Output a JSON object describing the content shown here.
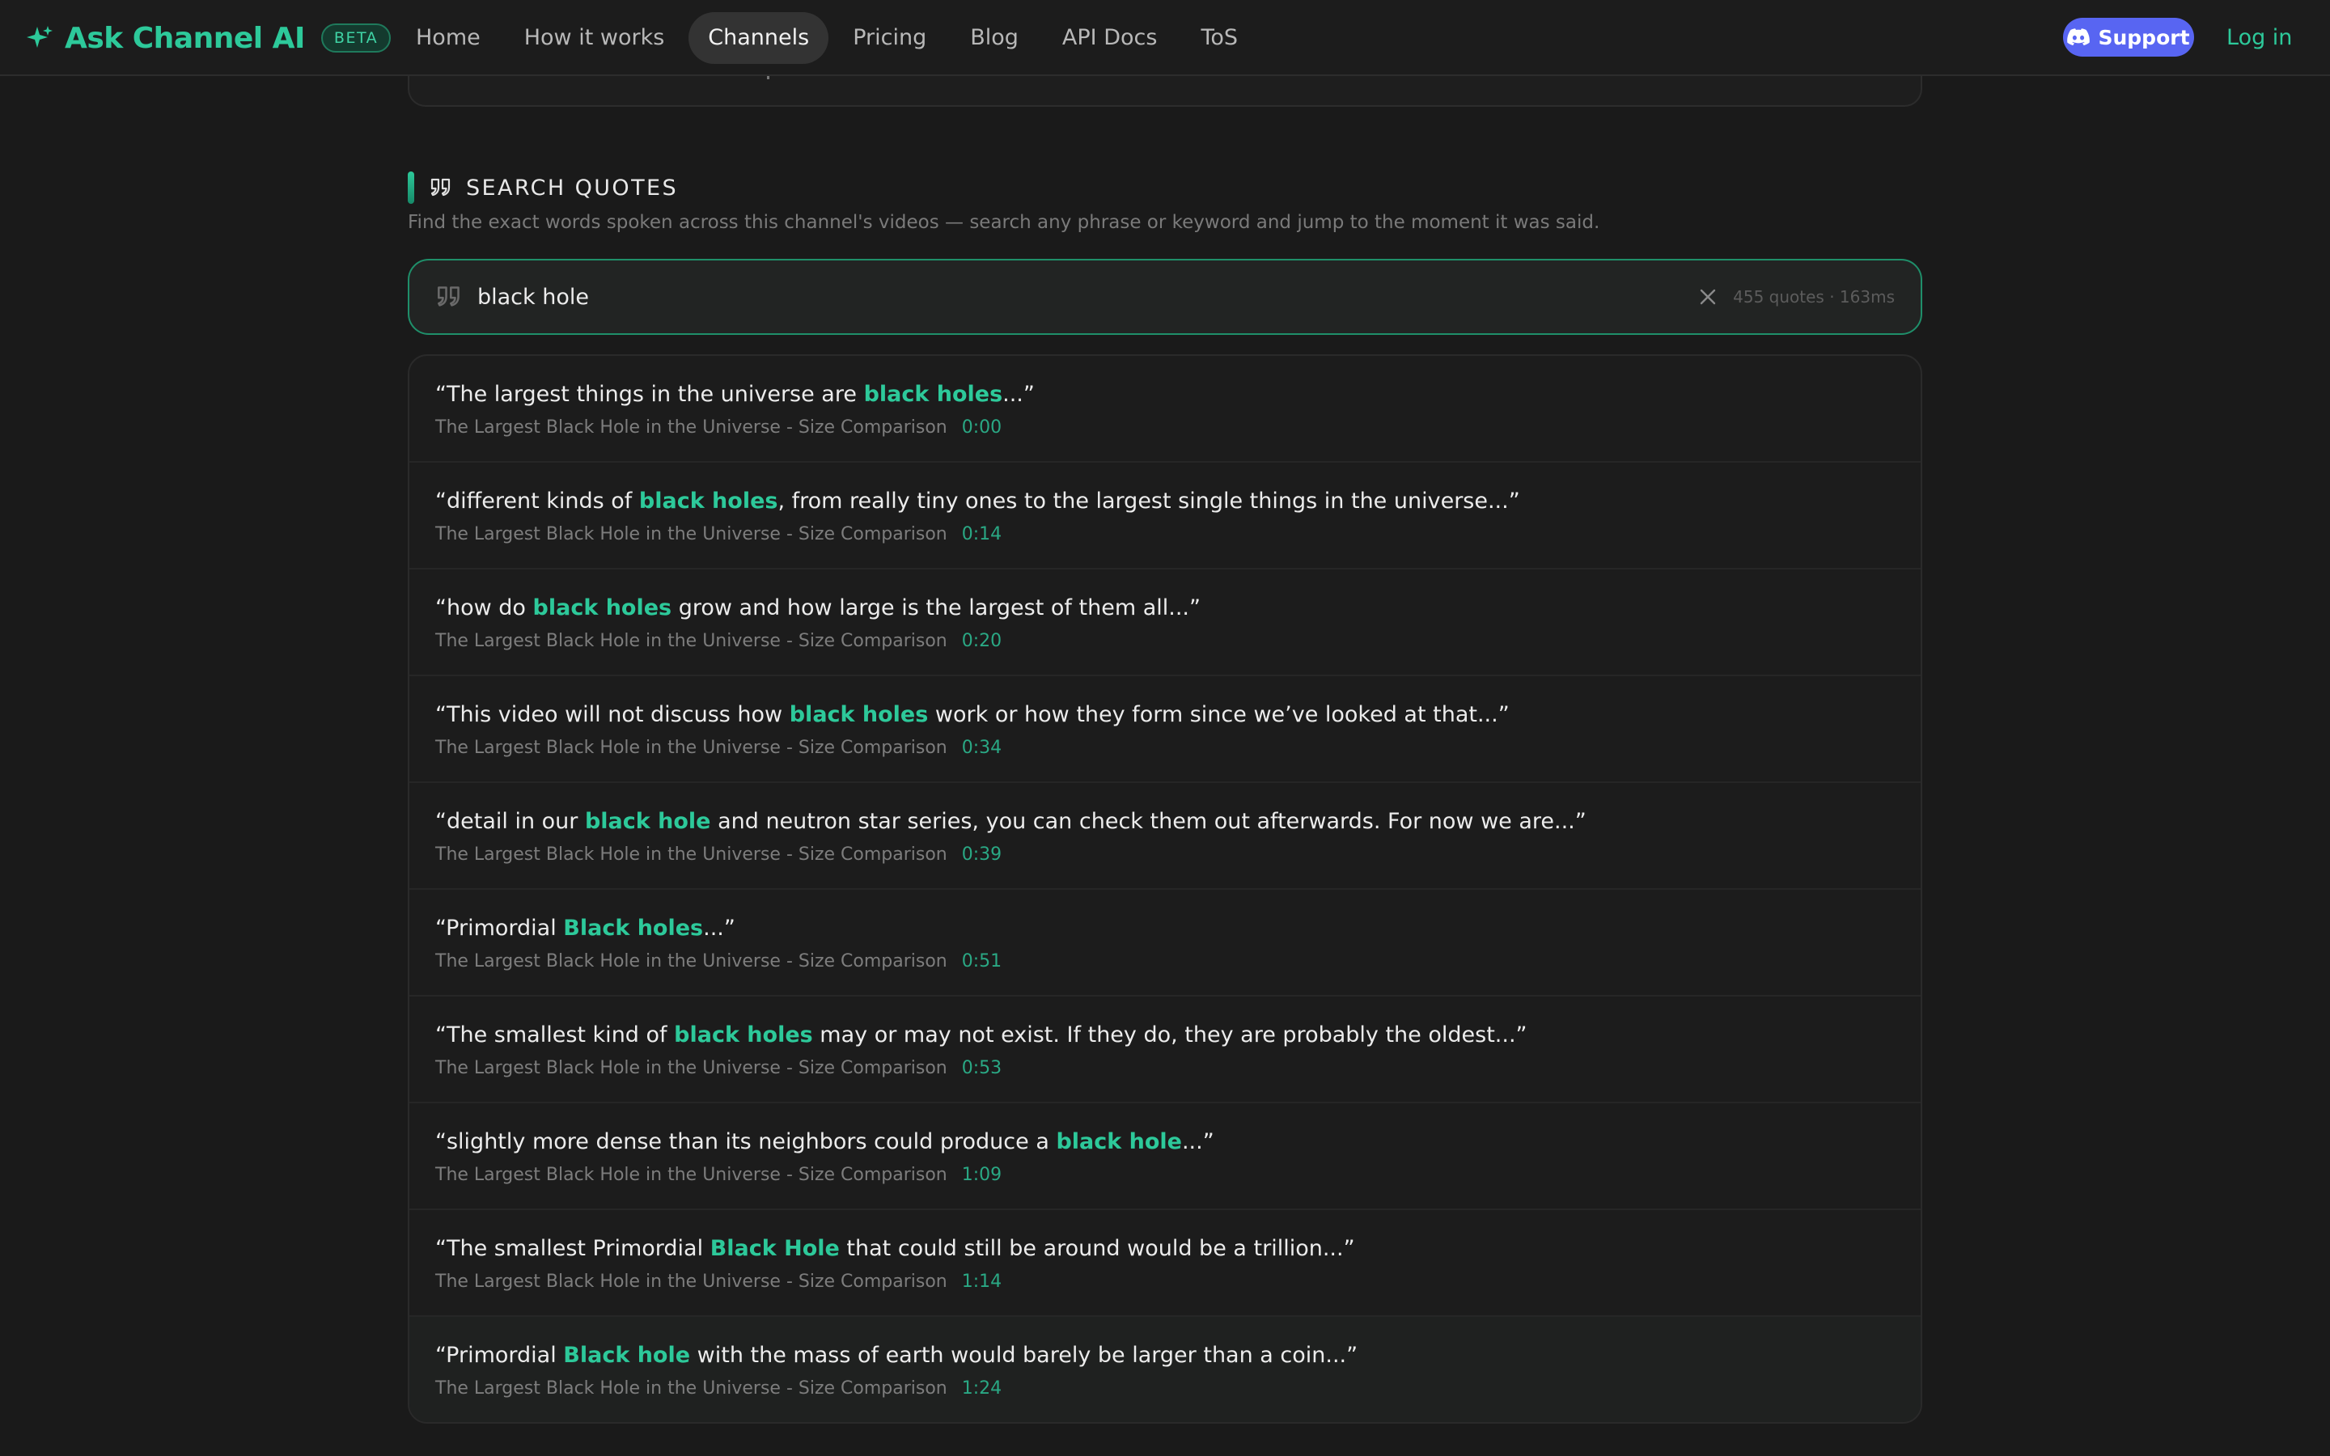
{
  "brand": {
    "name": "Ask Channel AI",
    "badge": "BETA"
  },
  "nav": {
    "items": [
      {
        "label": "Home",
        "active": false
      },
      {
        "label": "How it works",
        "active": false
      },
      {
        "label": "Channels",
        "active": true
      },
      {
        "label": "Pricing",
        "active": false
      },
      {
        "label": "Blog",
        "active": false
      },
      {
        "label": "API Docs",
        "active": false
      },
      {
        "label": "ToS",
        "active": false
      }
    ],
    "support_label": "Support",
    "login_label": "Log in"
  },
  "section": {
    "title": "SEARCH QUOTES",
    "description": "Find the exact words spoken across this channel's videos — search any phrase or keyword and jump to the moment it was said."
  },
  "search": {
    "value": "black hole",
    "meta": "455 quotes · 163ms"
  },
  "results": [
    {
      "before": "“The largest things in the  universe are ",
      "match": "black holes",
      "after": "...”",
      "video": "The Largest Black Hole in the Universe - Size Comparison",
      "time": "0:00"
    },
    {
      "before": "“different kinds of ",
      "match": "black holes",
      "after": ", from really tiny  ones to the largest single things in the universe...”",
      "video": "The Largest Black Hole in the Universe - Size Comparison",
      "time": "0:14"
    },
    {
      "before": "“how do ",
      "match": "black holes",
      "after": " grow and how  large is the largest of them all...”",
      "video": "The Largest Black Hole in the Universe - Size Comparison",
      "time": "0:20"
    },
    {
      "before": "“This video will not discuss how ",
      "match": "black holes",
      "after": " work  or how they form since we’ve looked at that...”",
      "video": "The Largest Black Hole in the Universe - Size Comparison",
      "time": "0:34"
    },
    {
      "before": "“detail in our ",
      "match": "black hole",
      "after": " and neutron star series,  you can check them out afterwards. For now we are...”",
      "video": "The Largest Black Hole in the Universe - Size Comparison",
      "time": "0:39"
    },
    {
      "before": "“Primordial ",
      "match": "Black holes",
      "after": "...”",
      "video": "The Largest Black Hole in the Universe - Size Comparison",
      "time": "0:51"
    },
    {
      "before": "“The smallest kind of ",
      "match": "black holes",
      "after": " may or may not  exist. If they do, they are probably the oldest...”",
      "video": "The Largest Black Hole in the Universe - Size Comparison",
      "time": "0:53"
    },
    {
      "before": "“slightly more dense than  its neighbors could produce a ",
      "match": "black hole",
      "after": "...”",
      "video": "The Largest Black Hole in the Universe - Size Comparison",
      "time": "1:09"
    },
    {
      "before": "“The smallest Primordial ",
      "match": "Black Hole",
      "after": " that  could still be around would be a trillion...”",
      "video": "The Largest Black Hole in the Universe - Size Comparison",
      "time": "1:14"
    },
    {
      "before": "“Primordial ",
      "match": "Black hole",
      "after": " with the mass of  earth would barely be larger than a coin...”",
      "video": "The Largest Black Hole in the Universe - Size Comparison",
      "time": "1:24"
    }
  ],
  "colors": {
    "accent": "#2dc99a",
    "discord": "#5865f2",
    "background": "#1a1a1a"
  },
  "icons": [
    "sparkle-logo-icon",
    "discord-icon",
    "quote-icon",
    "close-icon"
  ]
}
